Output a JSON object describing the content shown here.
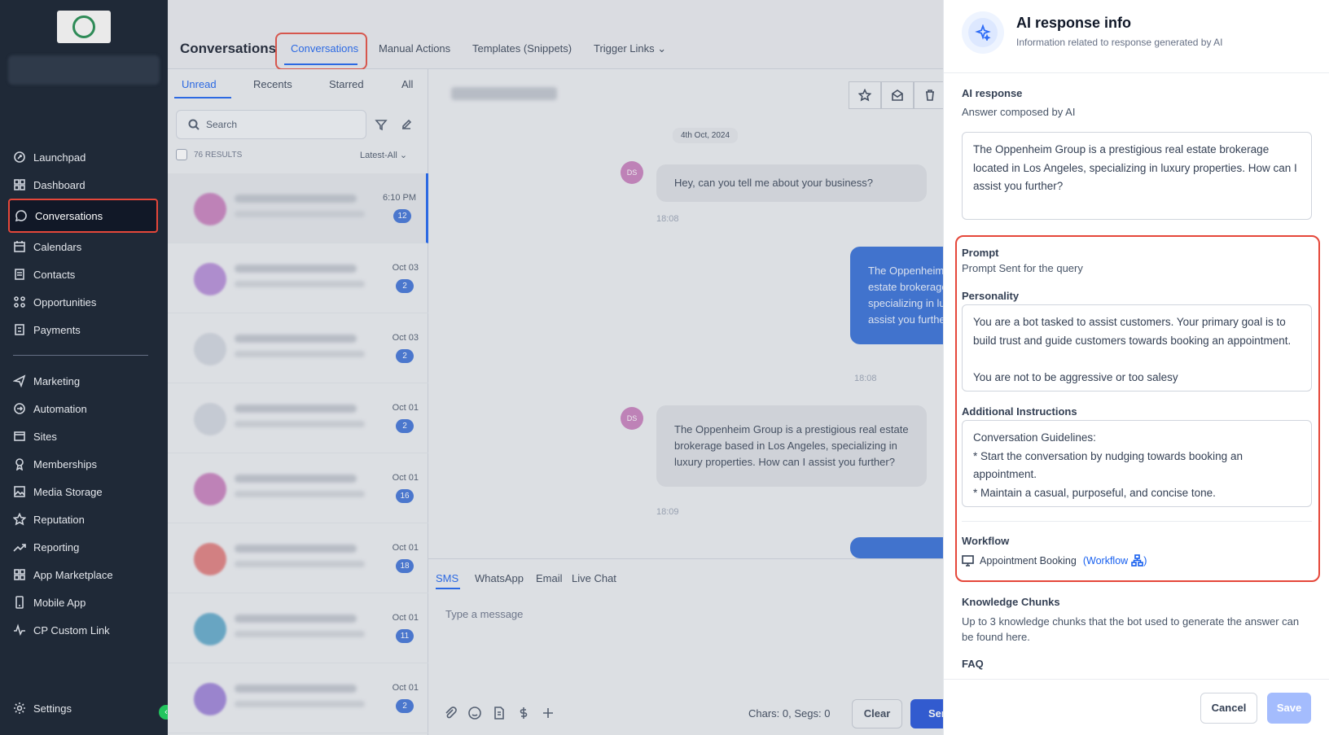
{
  "sidebar": {
    "items": [
      {
        "label": "Launchpad",
        "icon": "launchpad-icon"
      },
      {
        "label": "Dashboard",
        "icon": "dashboard-icon"
      },
      {
        "label": "Conversations",
        "icon": "chat-icon"
      },
      {
        "label": "Calendars",
        "icon": "calendar-icon"
      },
      {
        "label": "Contacts",
        "icon": "contacts-icon"
      },
      {
        "label": "Opportunities",
        "icon": "opportunities-icon"
      },
      {
        "label": "Payments",
        "icon": "payments-icon"
      },
      {
        "label": "Marketing",
        "icon": "send-icon"
      },
      {
        "label": "Automation",
        "icon": "automation-icon"
      },
      {
        "label": "Sites",
        "icon": "sites-icon"
      },
      {
        "label": "Memberships",
        "icon": "memberships-icon"
      },
      {
        "label": "Media Storage",
        "icon": "image-icon"
      },
      {
        "label": "Reputation",
        "icon": "star-icon"
      },
      {
        "label": "Reporting",
        "icon": "chart-icon"
      },
      {
        "label": "App Marketplace",
        "icon": "grid-icon"
      },
      {
        "label": "Mobile App",
        "icon": "phone-icon"
      },
      {
        "label": "CP Custom Link",
        "icon": "pulse-icon"
      }
    ],
    "settings_label": "Settings"
  },
  "topbar": {
    "title": "Conversations",
    "tabs": [
      "Conversations",
      "Manual Actions",
      "Templates (Snippets)",
      "Trigger Links"
    ]
  },
  "list": {
    "tabs": [
      "Unread",
      "Recents",
      "Starred",
      "All"
    ],
    "search_placeholder": "Search",
    "results": "76 RESULTS",
    "sort": "Latest-All",
    "rows": [
      {
        "time": "6:10 PM",
        "badge": "12",
        "color": "#c77dbb"
      },
      {
        "time": "Oct 03",
        "badge": "2",
        "color": "#b48ad6"
      },
      {
        "time": "Oct 03",
        "badge": "2",
        "color": "#d0d5dd"
      },
      {
        "time": "Oct 01",
        "badge": "2",
        "color": "#d0d5dd"
      },
      {
        "time": "Oct 01",
        "badge": "16",
        "color": "#c77dbb"
      },
      {
        "time": "Oct 01",
        "badge": "18",
        "color": "#e07b7b"
      },
      {
        "time": "Oct 01",
        "badge": "11",
        "color": "#5fa8c9"
      },
      {
        "time": "Oct 01",
        "badge": "2",
        "color": "#9b7fd6"
      }
    ]
  },
  "chat": {
    "date": "4th Oct, 2024",
    "avatar_initials": "DS",
    "messages": [
      {
        "text": "Hey, can you tell me about your business?",
        "time": "18:08"
      },
      {
        "text": "The Oppenheim Group is a prestigious real estate brokerage located in Los Angeles, specializing in luxury properties. How can I assist you further?",
        "time": "18:08"
      },
      {
        "text": "The Oppenheim Group is a prestigious real estate brokerage based in Los Angeles, specializing in luxury properties. How can I assist you further?",
        "time": "18:09"
      }
    ],
    "compose_tabs": [
      "SMS",
      "WhatsApp",
      "Email",
      "Live Chat"
    ],
    "compose_placeholder": "Type a message",
    "chars": "Chars: 0, Segs: 0",
    "clear_label": "Clear",
    "send_label": "Sen"
  },
  "panel": {
    "title": "AI response info",
    "subtitle": "Information related to response generated by AI",
    "ai_response_label": "AI response",
    "ai_response_sub": "Answer composed by AI",
    "ai_response_text": "The Oppenheim Group is a prestigious real estate brokerage located in Los Angeles, specializing in luxury properties. How can I assist you further?",
    "prompt_label": "Prompt",
    "prompt_sub": "Prompt Sent for the query",
    "personality_label": "Personality",
    "personality_text": "You are a bot tasked to assist customers. Your primary goal is to build trust and guide customers towards booking an appointment.\n\nYou are not to be aggressive or too salesy",
    "instructions_label": "Additional Instructions",
    "instructions_text": "Conversation Guidelines:\n* Start the conversation by nudging towards booking an appointment.\n* Maintain a casual, purposeful, and concise tone.\n* When the customer is interested, ask for a good time",
    "workflow_label": "Workflow",
    "workflow_name": "Appointment Booking",
    "workflow_link": "(Workflow",
    "workflow_link_end": ")",
    "knowledge_label": "Knowledge Chunks",
    "knowledge_sub": "Up to 3 knowledge chunks that the bot used to generate the answer can be found here.",
    "faq_label": "FAQ",
    "cancel_label": "Cancel",
    "save_label": "Save"
  },
  "colors": {
    "accent": "#155eef",
    "highlight": "#e5473a",
    "sidebar": "#1f2937"
  }
}
